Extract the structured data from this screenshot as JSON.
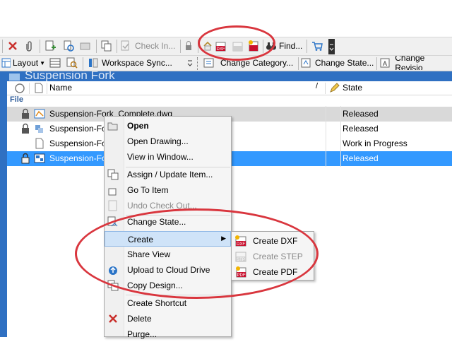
{
  "toolbar1": {
    "checkin_label": "Check In...",
    "find_label": "Find..."
  },
  "toolbar2": {
    "layout_label": "Layout",
    "workspace_sync_label": "Workspace Sync...",
    "change_category_label": "Change Category...",
    "change_state_label": "Change State...",
    "change_revision_label": "Change Revisio"
  },
  "folder": {
    "title": "Suspension Fork"
  },
  "columns": {
    "name": "Name",
    "state": "State"
  },
  "group_label": "File",
  "rows": [
    {
      "name": "Suspension-Fork_Complete.dwg",
      "state": "Released"
    },
    {
      "name": "Suspension-Fo",
      "state": "Released"
    },
    {
      "name": "Suspension-Fo",
      "state": "Work in Progress"
    },
    {
      "name": "Suspension-Fo",
      "state": "Released"
    }
  ],
  "context_menu": {
    "open": "Open",
    "open_drawing": "Open Drawing...",
    "view_in_window": "View in Window...",
    "assign_update": "Assign / Update Item...",
    "go_to_item": "Go To Item",
    "undo_checkout": "Undo Check Out...",
    "change_state": "Change State...",
    "create": "Create",
    "share_view": "Share View",
    "upload_cloud": "Upload to Cloud Drive",
    "copy_design": "Copy Design...",
    "create_shortcut": "Create Shortcut",
    "delete": "Delete",
    "purge": "Purge..."
  },
  "submenu": {
    "create_dxf": "Create DXF",
    "create_step": "Create STEP",
    "create_pdf": "Create PDF"
  },
  "icons": {
    "dxf_badge": "DXF",
    "step_badge": "STP",
    "pdf_badge": "PDF"
  },
  "colors": {
    "selection_blue": "#3399ff",
    "folder_header": "#2f70c2",
    "annotation_red": "#d9363e"
  }
}
